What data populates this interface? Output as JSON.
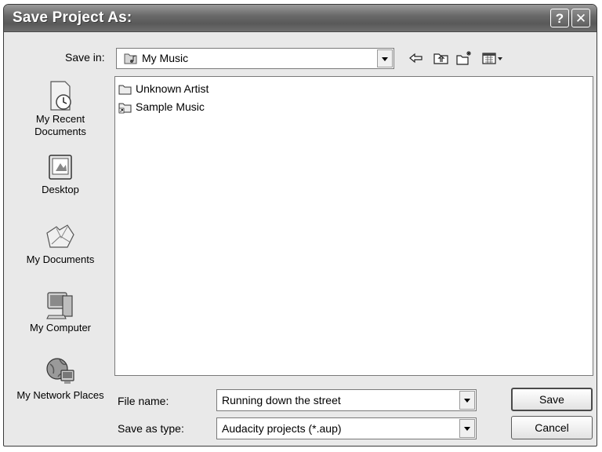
{
  "window": {
    "title": "Save Project As:",
    "help_glyph": "?",
    "close_glyph": "✕"
  },
  "save_in": {
    "label": "Save in:",
    "value": "My Music",
    "icon": "music-folder-icon"
  },
  "toolbar": {
    "icons": [
      "back-arrow-icon",
      "up-folder-icon",
      "new-folder-icon",
      "views-menu-icon"
    ]
  },
  "places": [
    {
      "label": "My Recent Documents",
      "icon": "recent-documents-icon"
    },
    {
      "label": "Desktop",
      "icon": "desktop-icon"
    },
    {
      "label": "My Documents",
      "icon": "my-documents-icon"
    },
    {
      "label": "My Computer",
      "icon": "my-computer-icon"
    },
    {
      "label": "My Network Places",
      "icon": "network-places-icon"
    }
  ],
  "files": [
    {
      "name": "Unknown Artist",
      "icon": "folder-icon"
    },
    {
      "name": "Sample Music",
      "icon": "shortcut-folder-icon"
    }
  ],
  "file_name": {
    "label": "File name:",
    "value": "Running down the street"
  },
  "save_as_type": {
    "label": "Save as type:",
    "value": "Audacity projects (*.aup)"
  },
  "buttons": {
    "save": "Save",
    "cancel": "Cancel"
  }
}
